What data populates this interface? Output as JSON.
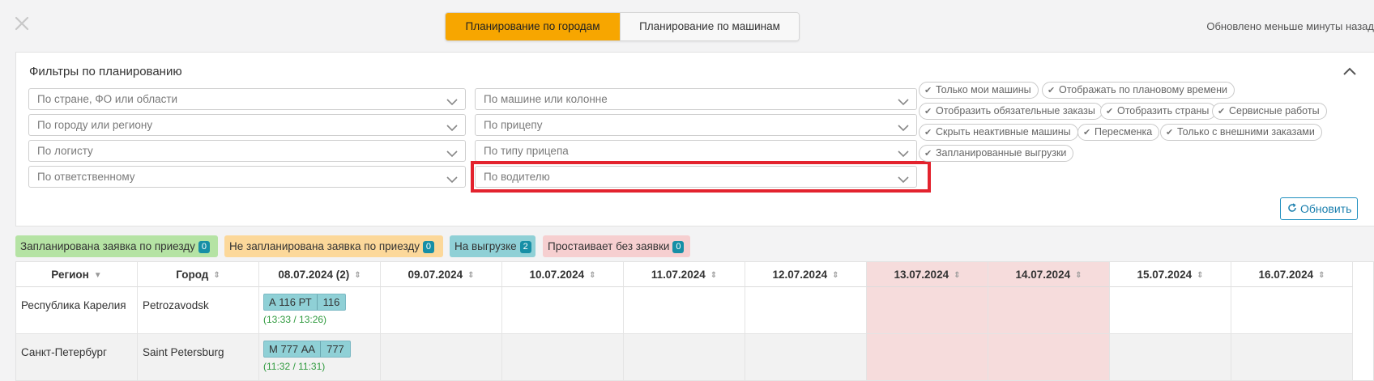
{
  "header": {
    "tabs": [
      {
        "label": "Планирование по городам",
        "active": true
      },
      {
        "label": "Планирование по машинам",
        "active": false
      }
    ],
    "updated_text": "Обновлено меньше минуты назад"
  },
  "filters": {
    "title": "Фильтры по планированию",
    "selects_col1": [
      "По стране, ФО или области",
      "По городу или региону",
      "По логисту",
      "По ответственному"
    ],
    "selects_col2": [
      "По машине или колонне",
      "По прицепу",
      "По типу прицепа",
      "По водителю"
    ],
    "chips": [
      "Только мои машины",
      "Отображать по плановому времени",
      "Отобразить обязательные заказы",
      "Отобразить страны",
      "Сервисные работы",
      "Скрыть неактивные машины",
      "Пересменка",
      "Только с внешними заказами",
      "Запланированные выгрузки"
    ],
    "refresh_label": "Обновить"
  },
  "legend": [
    {
      "label": "Запланирована заявка по приезду",
      "count": "0",
      "color": "#b5e3a4"
    },
    {
      "label": "Не запланирована заявка по приезду",
      "count": "0",
      "color": "#fcd89a"
    },
    {
      "label": "На выгрузке",
      "count": "2",
      "color": "#8fd0d6"
    },
    {
      "label": "Простаивает без заявки",
      "count": "0",
      "color": "#f6cfd0"
    }
  ],
  "table": {
    "columns": [
      "Регион",
      "Город",
      "08.07.2024 (2)",
      "09.07.2024",
      "10.07.2024",
      "11.07.2024",
      "12.07.2024",
      "13.07.2024",
      "14.07.2024",
      "15.07.2024",
      "16.07.2024"
    ],
    "rows": [
      {
        "region": "Республика Карелия",
        "city": "Petrozavodsk",
        "plate": "А 116 РТ",
        "truck": "116",
        "time": "(13:33 / 13:26)"
      },
      {
        "region": "Санкт-Петербург",
        "city": "Saint Petersburg",
        "plate": "М 777 АА",
        "truck": "777",
        "time": "(11:32 / 11:31)"
      }
    ]
  },
  "colors": {
    "accent": "#f7a600",
    "highlight": "#e3232e",
    "weekend": "#f6dcdc",
    "badge": "#178fa6"
  }
}
